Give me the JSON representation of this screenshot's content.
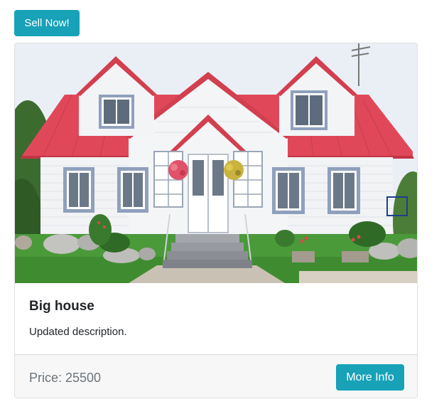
{
  "header": {
    "sell_button_label": "Sell Now!"
  },
  "card": {
    "image_alt": "house-photo",
    "title": "Big house",
    "description": "Updated description.",
    "price_text": "Price: 25500",
    "more_info_label": "More Info"
  },
  "colors": {
    "accent": "#17a2b8",
    "roof": "#e0485a",
    "house_wall": "#f2f4f6",
    "window_frame": "#8fa0bc",
    "grass": "#3f9a36",
    "sky": "#e9eef4"
  }
}
